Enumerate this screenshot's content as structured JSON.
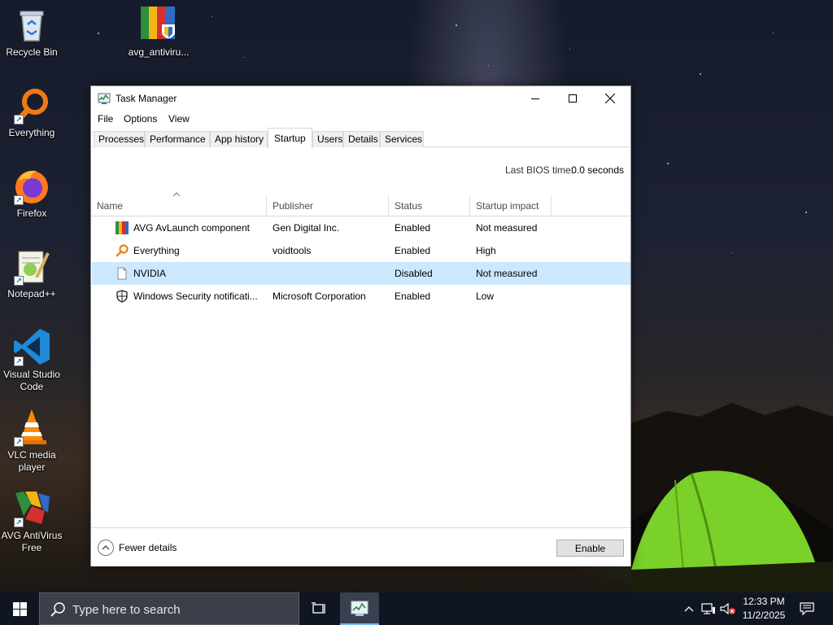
{
  "desktop": {
    "icons": [
      {
        "label": "Recycle Bin"
      },
      {
        "label": "avg_antiviru..."
      },
      {
        "label": "Everything"
      },
      {
        "label": "Firefox"
      },
      {
        "label": "Notepad++"
      },
      {
        "label": "Visual Studio Code"
      },
      {
        "label": "VLC media player"
      },
      {
        "label": "AVG AntiVirus Free"
      }
    ]
  },
  "window": {
    "title": "Task Manager",
    "icon": "task-manager-icon",
    "controls": [
      "minimize-icon",
      "maximize-icon",
      "close-icon"
    ]
  },
  "menu": [
    "File",
    "Options",
    "View"
  ],
  "tabs": [
    {
      "label": "Processes",
      "active": false
    },
    {
      "label": "Performance",
      "active": false
    },
    {
      "label": "App history",
      "active": false
    },
    {
      "label": "Startup",
      "active": true
    },
    {
      "label": "Users",
      "active": false
    },
    {
      "label": "Details",
      "active": false
    },
    {
      "label": "Services",
      "active": false
    }
  ],
  "bios": {
    "label": "Last BIOS time:",
    "value": "0.0 seconds"
  },
  "table": {
    "columns": [
      "Name",
      "Publisher",
      "Status",
      "Startup impact"
    ],
    "sort_column": "Name",
    "sort_direction": "ascending",
    "rows": [
      {
        "name": "AVG AvLaunch component",
        "publisher": "Gen Digital Inc.",
        "status": "Enabled",
        "impact": "Not measured",
        "icon": "avg-icon",
        "selected": false
      },
      {
        "name": "Everything",
        "publisher": "voidtools",
        "status": "Enabled",
        "impact": "High",
        "icon": "magnifier-icon",
        "selected": false
      },
      {
        "name": "NVIDIA",
        "publisher": "",
        "status": "Disabled",
        "impact": "Not measured",
        "icon": "file-icon",
        "selected": true
      },
      {
        "name": "Windows Security notificati...",
        "publisher": "Microsoft Corporation",
        "status": "Enabled",
        "impact": "Low",
        "icon": "shield-icon",
        "selected": false
      }
    ]
  },
  "footer": {
    "fewer_details": "Fewer details",
    "action_button": "Enable"
  },
  "taskbar": {
    "search_placeholder": "Type here to search",
    "time": "12:33 PM",
    "date": "11/2/2025"
  },
  "colors": {
    "selection": "#cce8ff",
    "taskbar": "#101522",
    "accent": "#76b9ed"
  }
}
